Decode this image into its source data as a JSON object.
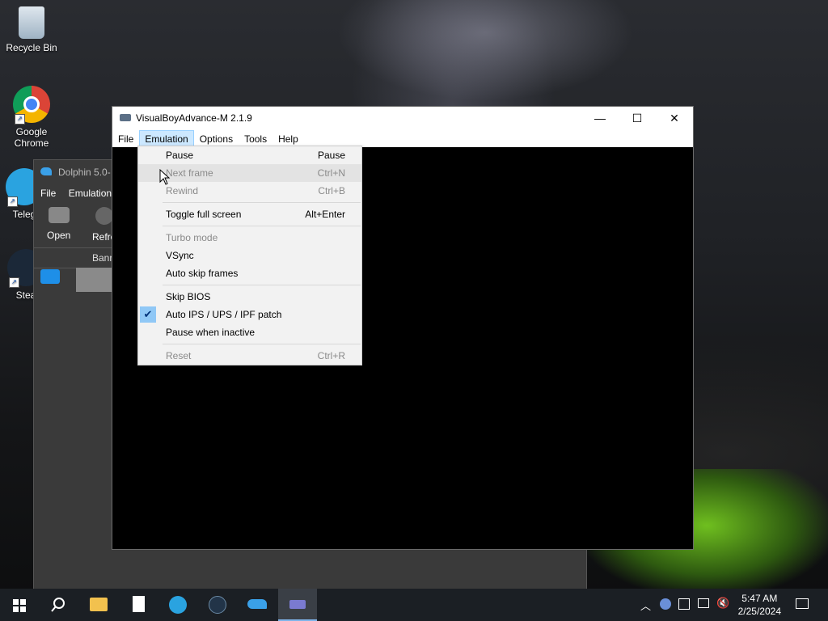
{
  "desktop": {
    "icons": [
      {
        "label": "Recycle Bin",
        "icon": "recycle-bin-icon"
      },
      {
        "label": "Google\nChrome",
        "icon": "chrome-icon"
      },
      {
        "label": "Teleg",
        "icon": "telegram-icon"
      },
      {
        "label": "Stea",
        "icon": "steam-icon"
      }
    ]
  },
  "dolphin": {
    "title": "Dolphin 5.0-",
    "menu": [
      "File",
      "Emulation"
    ],
    "toolbar": {
      "open": "Open",
      "refresh": "Refre"
    },
    "column_banner": "Banr"
  },
  "vba": {
    "title": "VisualBoyAdvance-M 2.1.9",
    "menu": [
      "File",
      "Emulation",
      "Options",
      "Tools",
      "Help"
    ],
    "active_menu": "Emulation"
  },
  "emulation_menu": {
    "items": [
      {
        "label": "Pause",
        "accel": "Pause",
        "enabled": true
      },
      {
        "label": "Next frame",
        "accel": "Ctrl+N",
        "enabled": false
      },
      {
        "label": "Rewind",
        "accel": "Ctrl+B",
        "enabled": false
      },
      {
        "label": "Toggle full screen",
        "accel": "Alt+Enter",
        "enabled": true
      },
      {
        "label": "Turbo mode",
        "accel": "",
        "enabled": false
      },
      {
        "label": "VSync",
        "accel": "",
        "enabled": true
      },
      {
        "label": "Auto skip frames",
        "accel": "",
        "enabled": true
      },
      {
        "label": "Skip BIOS",
        "accel": "",
        "enabled": true
      },
      {
        "label": "Auto IPS / UPS / IPF patch",
        "accel": "",
        "enabled": true,
        "checked": true
      },
      {
        "label": "Pause when inactive",
        "accel": "",
        "enabled": true
      },
      {
        "label": "Reset",
        "accel": "Ctrl+R",
        "enabled": false
      }
    ]
  },
  "taskbar": {
    "time": "5:47 AM",
    "date": "2/25/2024",
    "accent": "#7fb4ea"
  }
}
